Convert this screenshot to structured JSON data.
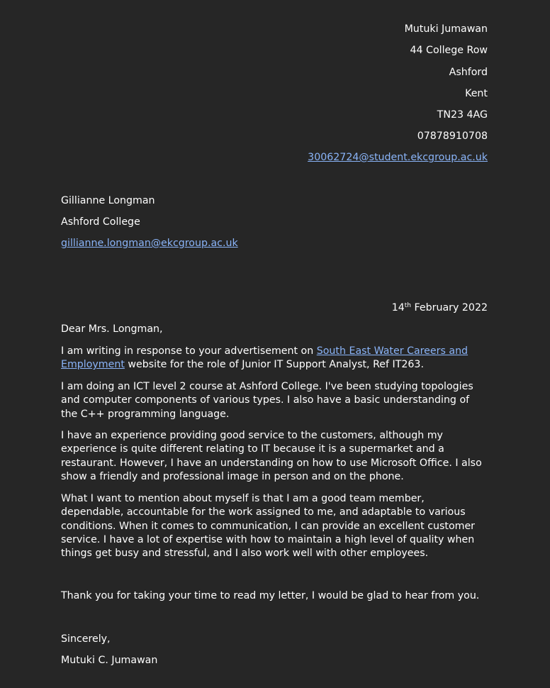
{
  "sender": {
    "name": "Mutuki Jumawan",
    "street": "44 College Row",
    "town": "Ashford",
    "county": "Kent",
    "postcode": "TN23 4AG",
    "phone": "07878910708",
    "email": "30062724@student.ekcgroup.ac.uk"
  },
  "recipient": {
    "name": "Gillianne Longman",
    "organisation": "Ashford College",
    "email": "gillianne.longman@ekcgroup.ac.uk"
  },
  "date": {
    "day": "14",
    "suffix": "th",
    "rest": " February 2022"
  },
  "salutation": "Dear Mrs. Longman,",
  "body": {
    "p1_before": "I am writing in response to your advertisement on ",
    "p1_link": "South East Water Careers and Employment",
    "p1_after": " website for the role of Junior IT Support Analyst, Ref IT263.",
    "p2": "I am doing an ICT level 2 course at Ashford College. I've been studying topologies and computer components of various types. I also have a basic understanding of the C++ programming language.",
    "p3": "I have an experience providing good service to the customers, although my experience is quite different relating to IT because it is a supermarket and a restaurant. However, I have an understanding on how to use Microsoft Office. I also show a friendly and professional image in person and on the phone.",
    "p4": "What I want to mention about myself is that I am a good team member, dependable, accountable for the work assigned to me, and adaptable to various conditions. When it comes to communication, I can provide an excellent customer service. I have a lot of expertise with how to maintain a high level of quality when things get busy and stressful, and I also work well with other employees.",
    "closing_line": "Thank you for taking your time to read my letter, I would be glad to hear from you."
  },
  "signoff": "Sincerely,",
  "signature": "Mutuki C. Jumawan"
}
